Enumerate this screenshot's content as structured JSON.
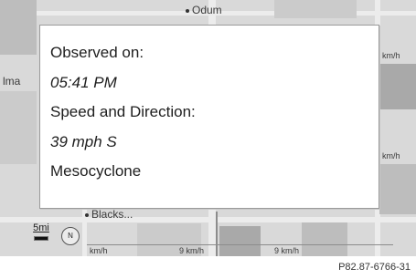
{
  "map": {
    "places": {
      "odum": "Odum",
      "ilma": "lma",
      "blacks": "Blacks..."
    },
    "speed_unit_label": "km/h",
    "speed_tags": [
      "km/h",
      "km/h",
      "km/h",
      "9 km/h",
      "9 km/h"
    ],
    "scale_label": "5mi",
    "compass_label": "N"
  },
  "popup": {
    "observed_label": "Observed on:",
    "observed_value": "05:41 PM",
    "speed_label": "Speed and Direction:",
    "speed_value": "39 mph S",
    "phenomenon": "Mesocyclone"
  },
  "caption": "P82.87-6766-31"
}
